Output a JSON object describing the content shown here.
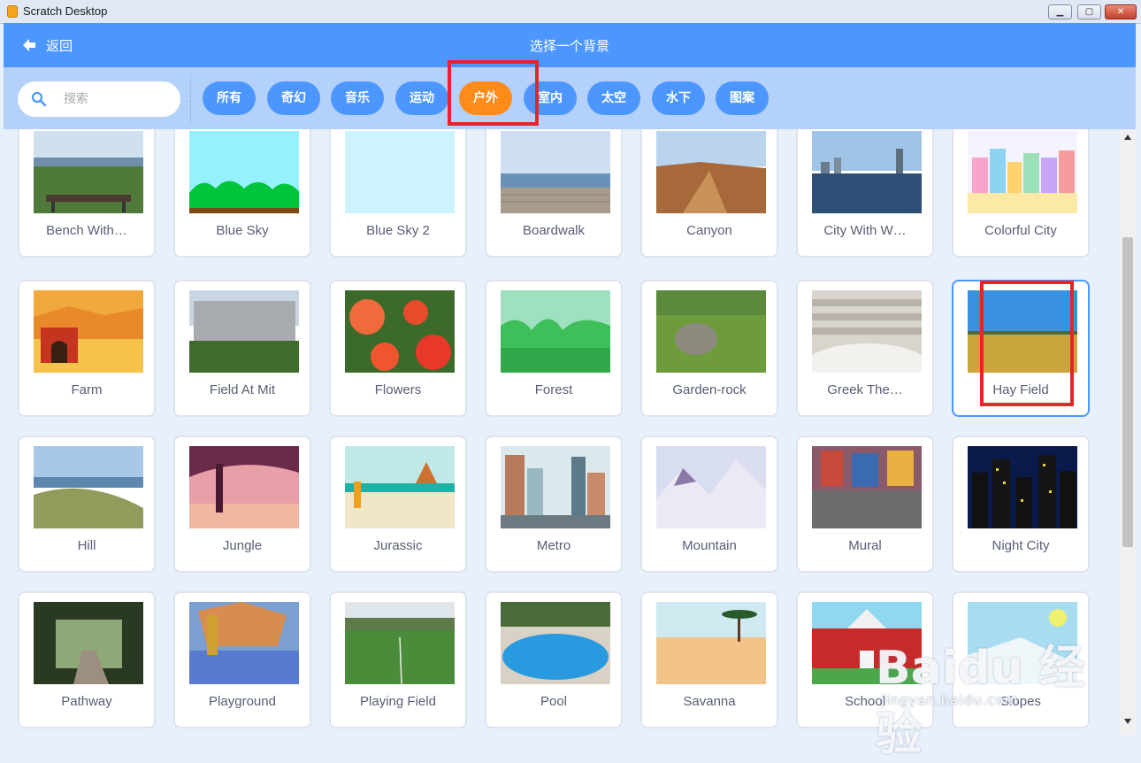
{
  "window": {
    "title": "Scratch Desktop",
    "minimize": "▁",
    "maximize": "▢",
    "close": "✕"
  },
  "header": {
    "back_label": "返回",
    "title": "选择一个背景"
  },
  "search": {
    "placeholder": "搜索",
    "value": ""
  },
  "tags": [
    {
      "label": "所有"
    },
    {
      "label": "奇幻"
    },
    {
      "label": "音乐"
    },
    {
      "label": "运动"
    },
    {
      "label": "户外",
      "active": true
    },
    {
      "label": "室内"
    },
    {
      "label": "太空"
    },
    {
      "label": "水下"
    },
    {
      "label": "图案"
    }
  ],
  "backdrops": [
    "Bench With…",
    "Blue Sky",
    "Blue Sky 2",
    "Boardwalk",
    "Canyon",
    "City With W…",
    "Colorful City",
    "Farm",
    "Field At Mit",
    "Flowers",
    "Forest",
    "Garden-rock",
    "Greek The…",
    "Hay Field",
    "Hill",
    "Jungle",
    "Jurassic",
    "Metro",
    "Mountain",
    "Mural",
    "Night City",
    "Pathway",
    "Playground",
    "Playing Field",
    "Pool",
    "Savanna",
    "School",
    "Slopes"
  ],
  "selected_backdrop": "Hay Field",
  "watermark": {
    "logo": "Baidu 经验",
    "url": "jingyan.baidu.com"
  },
  "colors": {
    "header": "#4c97ff",
    "filter_bar": "#b4d1fb",
    "active_tag": "#ff8c1a",
    "highlight": "#e8232a"
  }
}
